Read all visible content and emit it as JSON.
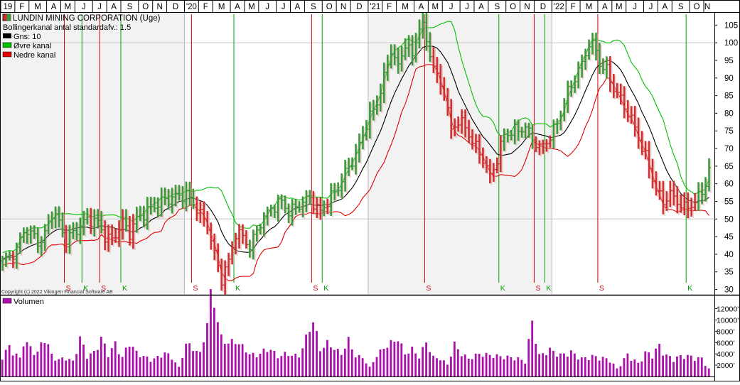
{
  "chart_data": {
    "type": "bar",
    "title": "LUNDIN MINING CORPORATION (Uge)",
    "legend": [
      {
        "label": "Bollingerkanal antal standardafv.: 1.5",
        "color": ""
      },
      {
        "label": "Gns: 10",
        "color": "#000000"
      },
      {
        "label": "Øvre kanal",
        "color": "#00c000"
      },
      {
        "label": "Nedre kanal",
        "color": "#e00000"
      }
    ],
    "legend_placement": "top-left",
    "copyright": "Copyright (c) 2022 Vikingen Financial Software AB",
    "price_axis": {
      "min": 30,
      "max": 105,
      "ticks": [
        30,
        35,
        40,
        45,
        50,
        55,
        60,
        65,
        70,
        75,
        80,
        85,
        90,
        95,
        100,
        105
      ],
      "position": "right"
    },
    "colors": {
      "up": "#3a9a3a",
      "down": "#d03030",
      "upper_band": "#00c000",
      "lower_band": "#e00000",
      "middle": "#000000",
      "volume": "#aa10aa",
      "signal_sell": "#d00000",
      "signal_buy": "#00a000"
    },
    "months": [
      {
        "label": "19",
        "start": 0,
        "weeks": 4
      },
      {
        "label": "F",
        "start": 4,
        "weeks": 4
      },
      {
        "label": "M",
        "start": 8,
        "weeks": 5
      },
      {
        "label": "A",
        "start": 13,
        "weeks": 4
      },
      {
        "label": "M",
        "start": 17,
        "weeks": 4
      },
      {
        "label": "J",
        "start": 21,
        "weeks": 5
      },
      {
        "label": "J",
        "start": 26,
        "weeks": 4
      },
      {
        "label": "A",
        "start": 30,
        "weeks": 4
      },
      {
        "label": "S",
        "start": 34,
        "weeks": 5
      },
      {
        "label": "O",
        "start": 39,
        "weeks": 4
      },
      {
        "label": "N",
        "start": 43,
        "weeks": 4
      },
      {
        "label": "D",
        "start": 47,
        "weeks": 5
      },
      {
        "label": "'20",
        "start": 52,
        "weeks": 4
      },
      {
        "label": "F",
        "start": 56,
        "weeks": 4
      },
      {
        "label": "M",
        "start": 60,
        "weeks": 5
      },
      {
        "label": "A",
        "start": 65,
        "weeks": 4
      },
      {
        "label": "M",
        "start": 69,
        "weeks": 4
      },
      {
        "label": "J",
        "start": 73,
        "weeks": 5
      },
      {
        "label": "J",
        "start": 78,
        "weeks": 4
      },
      {
        "label": "A",
        "start": 82,
        "weeks": 4
      },
      {
        "label": "S",
        "start": 86,
        "weeks": 5
      },
      {
        "label": "O",
        "start": 91,
        "weeks": 4
      },
      {
        "label": "N",
        "start": 95,
        "weeks": 4
      },
      {
        "label": "D",
        "start": 99,
        "weeks": 5
      },
      {
        "label": "'21",
        "start": 104,
        "weeks": 4
      },
      {
        "label": "F",
        "start": 108,
        "weeks": 4
      },
      {
        "label": "M",
        "start": 112,
        "weeks": 5
      },
      {
        "label": "A",
        "start": 117,
        "weeks": 4
      },
      {
        "label": "M",
        "start": 121,
        "weeks": 4
      },
      {
        "label": "J",
        "start": 125,
        "weeks": 5
      },
      {
        "label": "J",
        "start": 130,
        "weeks": 4
      },
      {
        "label": "A",
        "start": 134,
        "weeks": 4
      },
      {
        "label": "S",
        "start": 138,
        "weeks": 5
      },
      {
        "label": "O",
        "start": 143,
        "weeks": 4
      },
      {
        "label": "N",
        "start": 147,
        "weeks": 4
      },
      {
        "label": "D",
        "start": 151,
        "weeks": 5
      },
      {
        "label": "'22",
        "start": 156,
        "weeks": 4
      },
      {
        "label": "F",
        "start": 160,
        "weeks": 4
      },
      {
        "label": "M",
        "start": 164,
        "weeks": 5
      },
      {
        "label": "A",
        "start": 169,
        "weeks": 4
      },
      {
        "label": "M",
        "start": 173,
        "weeks": 4
      },
      {
        "label": "J",
        "start": 177,
        "weeks": 5
      },
      {
        "label": "J",
        "start": 182,
        "weeks": 4
      },
      {
        "label": "A",
        "start": 186,
        "weeks": 4
      },
      {
        "label": "S",
        "start": 190,
        "weeks": 5
      },
      {
        "label": "O",
        "start": 195,
        "weeks": 4
      },
      {
        "label": "N",
        "start": 199,
        "weeks": 2
      }
    ],
    "anchors_close": [
      [
        0,
        38
      ],
      [
        4,
        41
      ],
      [
        6,
        47
      ],
      [
        9,
        45
      ],
      [
        11,
        43
      ],
      [
        14,
        52
      ],
      [
        16,
        49
      ],
      [
        18,
        44
      ],
      [
        20,
        46
      ],
      [
        24,
        50
      ],
      [
        27,
        49
      ],
      [
        29,
        45
      ],
      [
        31,
        44
      ],
      [
        34,
        49
      ],
      [
        36,
        46
      ],
      [
        38,
        50
      ],
      [
        42,
        53
      ],
      [
        45,
        55
      ],
      [
        48,
        56
      ],
      [
        52,
        57
      ],
      [
        55,
        53
      ],
      [
        58,
        48
      ],
      [
        60,
        40
      ],
      [
        62,
        33
      ],
      [
        64,
        38
      ],
      [
        66,
        46
      ],
      [
        68,
        45
      ],
      [
        70,
        42
      ],
      [
        73,
        49
      ],
      [
        76,
        53
      ],
      [
        79,
        55
      ],
      [
        81,
        52
      ],
      [
        84,
        54
      ],
      [
        87,
        56
      ],
      [
        89,
        53
      ],
      [
        90,
        52
      ],
      [
        92,
        55
      ],
      [
        95,
        59
      ],
      [
        98,
        65
      ],
      [
        100,
        68
      ],
      [
        103,
        77
      ],
      [
        106,
        83
      ],
      [
        108,
        90
      ],
      [
        110,
        98
      ],
      [
        112,
        93
      ],
      [
        114,
        100
      ],
      [
        116,
        96
      ],
      [
        118,
        105
      ],
      [
        119,
        104
      ],
      [
        121,
        97
      ],
      [
        123,
        90
      ],
      [
        125,
        86
      ],
      [
        127,
        75
      ],
      [
        129,
        78
      ],
      [
        131,
        76
      ],
      [
        133,
        72
      ],
      [
        136,
        67
      ],
      [
        138,
        62
      ],
      [
        140,
        67
      ],
      [
        142,
        74
      ],
      [
        145,
        75
      ],
      [
        148,
        76
      ],
      [
        150,
        73
      ],
      [
        152,
        70
      ],
      [
        154,
        72
      ],
      [
        156,
        75
      ],
      [
        158,
        80
      ],
      [
        160,
        86
      ],
      [
        162,
        90
      ],
      [
        164,
        94
      ],
      [
        166,
        100
      ],
      [
        168,
        98
      ],
      [
        169,
        94
      ],
      [
        171,
        92
      ],
      [
        173,
        87
      ],
      [
        175,
        84
      ],
      [
        177,
        80
      ],
      [
        179,
        76
      ],
      [
        181,
        70
      ],
      [
        183,
        65
      ],
      [
        185,
        58
      ],
      [
        187,
        55
      ],
      [
        189,
        57
      ],
      [
        191,
        55
      ],
      [
        193,
        53
      ],
      [
        195,
        54
      ],
      [
        197,
        56
      ],
      [
        199,
        60
      ],
      [
        200,
        64
      ]
    ],
    "signals": [
      {
        "week": 18,
        "type": "S"
      },
      {
        "week": 23,
        "type": "K"
      },
      {
        "week": 28,
        "type": "S"
      },
      {
        "week": 34,
        "type": "K"
      },
      {
        "week": 54,
        "type": "S"
      },
      {
        "week": 66,
        "type": "K"
      },
      {
        "week": 88,
        "type": "S"
      },
      {
        "week": 91,
        "type": "K"
      },
      {
        "week": 120,
        "type": "S"
      },
      {
        "week": 141,
        "type": "K"
      },
      {
        "week": 151,
        "type": "S"
      },
      {
        "week": 154,
        "type": "K"
      },
      {
        "week": 169,
        "type": "S"
      },
      {
        "week": 194,
        "type": "K"
      }
    ],
    "volume": {
      "series_name": "Volumen",
      "axis_max": 13500,
      "ticks": [
        2000,
        4000,
        6000,
        8000,
        10000,
        12000
      ],
      "tick_labels": [
        "2000'",
        "4000'",
        "6000'",
        "8000'",
        "10000'",
        "12000'"
      ],
      "anchors": [
        [
          0,
          3500
        ],
        [
          2,
          5000
        ],
        [
          5,
          3000
        ],
        [
          6,
          6200
        ],
        [
          8,
          4800
        ],
        [
          10,
          4000
        ],
        [
          12,
          6800
        ],
        [
          14,
          3600
        ],
        [
          16,
          2800
        ],
        [
          18,
          3200
        ],
        [
          20,
          2500
        ],
        [
          22,
          6500
        ],
        [
          24,
          3500
        ],
        [
          26,
          4000
        ],
        [
          28,
          6500
        ],
        [
          30,
          3800
        ],
        [
          32,
          5500
        ],
        [
          34,
          3200
        ],
        [
          36,
          5800
        ],
        [
          38,
          4000
        ],
        [
          40,
          3400
        ],
        [
          42,
          2800
        ],
        [
          44,
          3200
        ],
        [
          46,
          4000
        ],
        [
          48,
          3200
        ],
        [
          50,
          1500
        ],
        [
          52,
          5500
        ],
        [
          54,
          4800
        ],
        [
          56,
          3800
        ],
        [
          58,
          9000
        ],
        [
          59,
          13500
        ],
        [
          60,
          12800
        ],
        [
          61,
          9200
        ],
        [
          62,
          6500
        ],
        [
          64,
          5600
        ],
        [
          66,
          6000
        ],
        [
          68,
          5000
        ],
        [
          70,
          3800
        ],
        [
          72,
          3500
        ],
        [
          74,
          4300
        ],
        [
          76,
          4600
        ],
        [
          78,
          3300
        ],
        [
          80,
          3800
        ],
        [
          84,
          3400
        ],
        [
          88,
          9500
        ],
        [
          90,
          4500
        ],
        [
          92,
          5600
        ],
        [
          96,
          3800
        ],
        [
          98,
          6100
        ],
        [
          100,
          3400
        ],
        [
          102,
          3200
        ],
        [
          104,
          1500
        ],
        [
          106,
          3500
        ],
        [
          108,
          4800
        ],
        [
          110,
          5600
        ],
        [
          112,
          6400
        ],
        [
          114,
          3800
        ],
        [
          116,
          4600
        ],
        [
          118,
          3300
        ],
        [
          120,
          5800
        ],
        [
          122,
          3200
        ],
        [
          124,
          3000
        ],
        [
          126,
          2000
        ],
        [
          128,
          5400
        ],
        [
          130,
          3800
        ],
        [
          132,
          3000
        ],
        [
          135,
          3800
        ],
        [
          138,
          3600
        ],
        [
          142,
          3300
        ],
        [
          144,
          3200
        ],
        [
          146,
          3000
        ],
        [
          148,
          2500
        ],
        [
          150,
          9200
        ],
        [
          152,
          3500
        ],
        [
          155,
          4500
        ],
        [
          158,
          3600
        ],
        [
          161,
          4100
        ],
        [
          164,
          3000
        ],
        [
          167,
          3400
        ],
        [
          170,
          3100
        ],
        [
          172,
          2800
        ],
        [
          174,
          1300
        ],
        [
          177,
          3700
        ],
        [
          180,
          2200
        ],
        [
          182,
          4000
        ],
        [
          184,
          3700
        ],
        [
          186,
          5200
        ],
        [
          188,
          3500
        ],
        [
          190,
          3000
        ],
        [
          193,
          3600
        ],
        [
          195,
          3300
        ],
        [
          198,
          3000
        ],
        [
          200,
          1300
        ]
      ]
    }
  }
}
